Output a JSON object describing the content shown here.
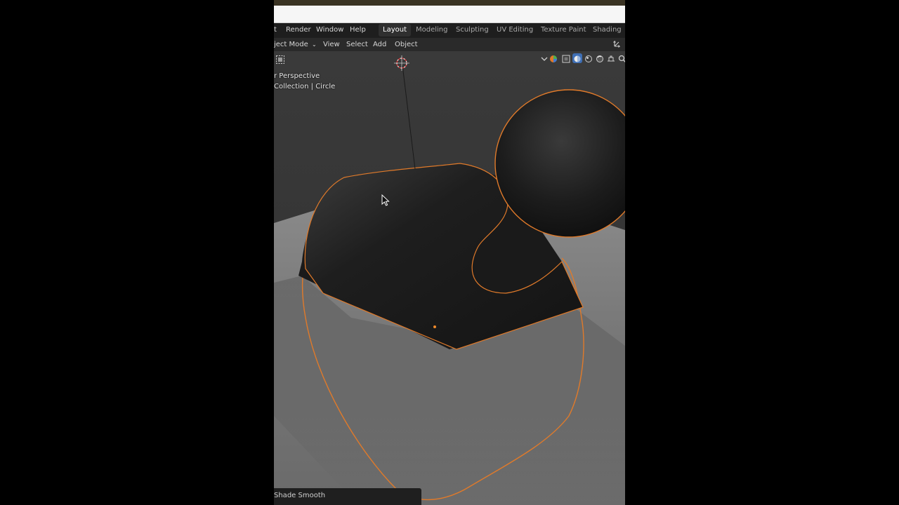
{
  "menubar": {
    "items": [
      "t",
      "Render",
      "Window",
      "Help"
    ],
    "workspaces": [
      "Layout",
      "Modeling",
      "Sculpting",
      "UV Editing",
      "Texture Paint",
      "Shading"
    ],
    "active_workspace": "Layout"
  },
  "header": {
    "mode": "ject Mode",
    "menus": [
      "View",
      "Select",
      "Add",
      "Object"
    ]
  },
  "viewport": {
    "view_label": "r Perspective",
    "collection_label": "Collection | Circle"
  },
  "status": {
    "last_operator": "Shade Smooth"
  },
  "icons": [
    "select-box-icon",
    "chevron-down-icon",
    "shading-color-icon",
    "wireframe-icon",
    "solid-icon",
    "material-preview-icon",
    "rendered-icon",
    "overlay-icon",
    "search-icon",
    "transform-gizmo-icon",
    "cursor-3d-icon",
    "mouse-pointer-icon"
  ],
  "colors": {
    "selection_outline": "#e07a2a",
    "menubar_bg": "#1e1e1e",
    "viewport_bg": "#363636"
  }
}
